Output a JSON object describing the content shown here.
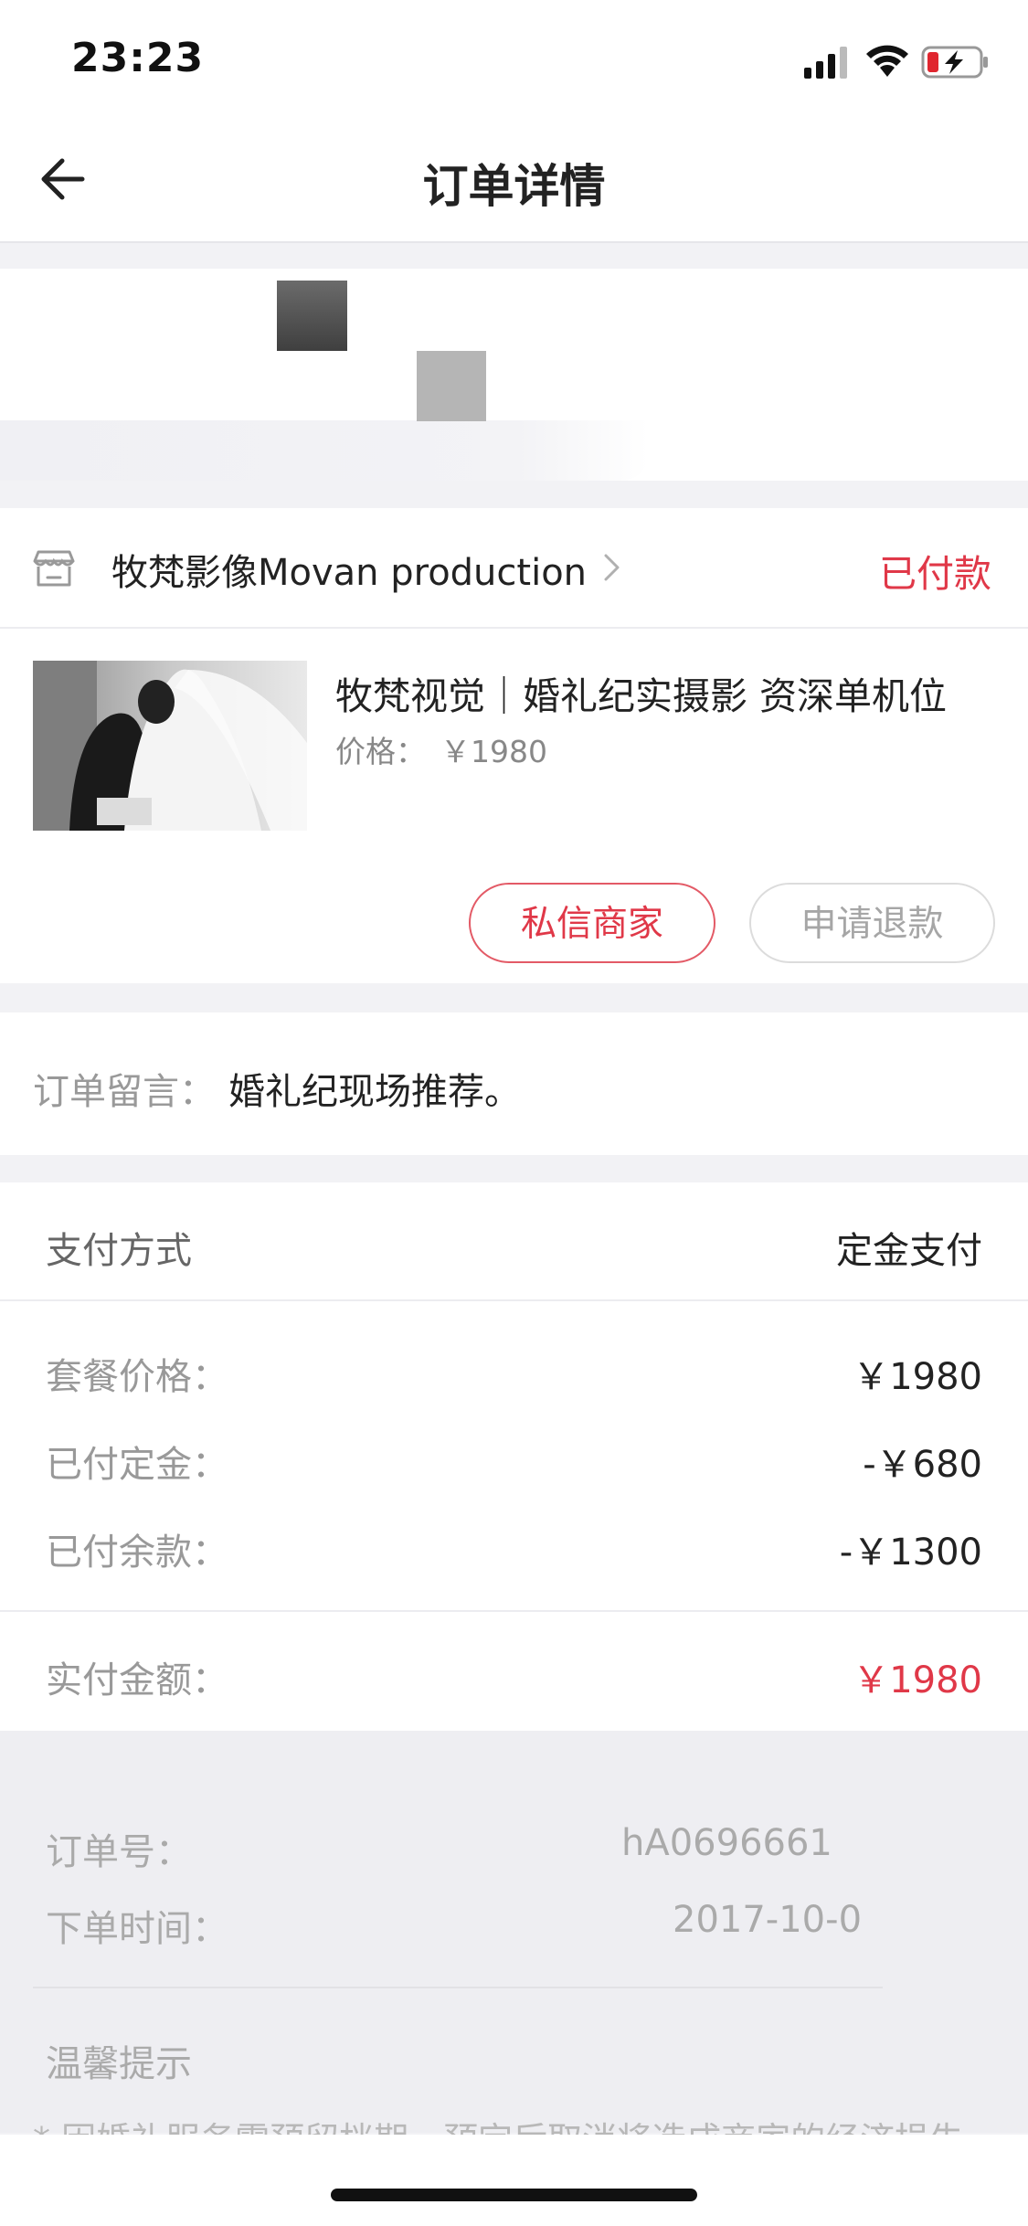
{
  "status_bar": {
    "time": "23:23"
  },
  "header": {
    "title": "订单详情"
  },
  "shop": {
    "name": "牧梵影像Movan production",
    "status": "已付款",
    "status_color": "#e03848"
  },
  "product": {
    "title": "牧梵视觉｜婚礼纪实摄影 资深单机位",
    "price_label": "价格：",
    "price": "￥1980"
  },
  "actions": {
    "message": "私信商家",
    "refund": "申请退款"
  },
  "note": {
    "label": "订单留言：",
    "text": "婚礼纪现场推荐。"
  },
  "payment": {
    "method_label": "支付方式",
    "method_value": "定金支付",
    "rows": [
      {
        "label": "套餐价格：",
        "value": "￥1980"
      },
      {
        "label": "已付定金：",
        "value": "-￥680"
      },
      {
        "label": "已付余款：",
        "value": "-￥1300"
      }
    ],
    "total_label": "实付金额：",
    "total_value": "￥1980"
  },
  "order_info": {
    "number_label": "订单号：",
    "number_value": "hA0696661",
    "time_label": "下单时间：",
    "time_value": "2017-10-0"
  },
  "tips": {
    "title": "温馨提示",
    "text": "* 因婚礼服务需预留档期，预定后取消将造成商家的经济损失"
  }
}
